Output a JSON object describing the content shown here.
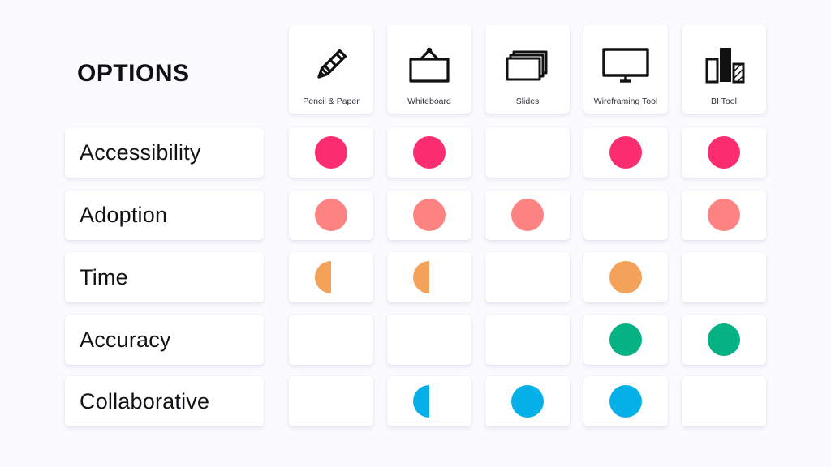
{
  "page": {
    "title": "OPTIONS",
    "background_color": "#FBFAFE"
  },
  "palette": {
    "pink": "#FB2C6F",
    "salmon": "#FD8383",
    "orange": "#F4A259",
    "green": "#05B283",
    "blue": "#05B0E8",
    "card": "#FFFFFF",
    "text": "#111014",
    "caption": "#33313B"
  },
  "columns": [
    {
      "label": "Pencil & Paper",
      "icon": "pencil-icon"
    },
    {
      "label": "Whiteboard",
      "icon": "whiteboard-icon"
    },
    {
      "label": "Slides",
      "icon": "slides-icon"
    },
    {
      "label": "Wireframing Tool",
      "icon": "monitor-icon"
    },
    {
      "label": "BI Tool",
      "icon": "bar-chart-icon"
    }
  ],
  "rows": [
    {
      "label": "Accessibility",
      "color": "#FB2C6F"
    },
    {
      "label": "Adoption",
      "color": "#FD8383"
    },
    {
      "label": "Time",
      "color": "#F4A259"
    },
    {
      "label": "Accuracy",
      "color": "#05B283"
    },
    {
      "label": "Collaborative",
      "color": "#05B0E8"
    }
  ],
  "chart_data": {
    "type": "heatmap",
    "title": "OPTIONS",
    "xlabel": "",
    "ylabel": "",
    "categories": [
      "Pencil & Paper",
      "Whiteboard",
      "Slides",
      "Wireframing Tool",
      "BI Tool"
    ],
    "row_categories": [
      "Accessibility",
      "Adoption",
      "Time",
      "Accuracy",
      "Collaborative"
    ],
    "value_scale": {
      "full": 1,
      "half": 0.5,
      "empty": 0
    },
    "series": [
      {
        "name": "Accessibility",
        "color": "#FB2C6F",
        "marks": [
          "full",
          "full",
          "empty",
          "full",
          "full"
        ],
        "values": [
          1,
          1,
          0,
          1,
          1
        ]
      },
      {
        "name": "Adoption",
        "color": "#FD8383",
        "marks": [
          "full",
          "full",
          "full",
          "empty",
          "full"
        ],
        "values": [
          1,
          1,
          1,
          0,
          1
        ]
      },
      {
        "name": "Time",
        "color": "#F4A259",
        "marks": [
          "half",
          "half",
          "empty",
          "full",
          "empty"
        ],
        "values": [
          0.5,
          0.5,
          0,
          1,
          0
        ]
      },
      {
        "name": "Accuracy",
        "color": "#05B283",
        "marks": [
          "empty",
          "empty",
          "empty",
          "full",
          "full"
        ],
        "values": [
          0,
          0,
          0,
          1,
          1
        ]
      },
      {
        "name": "Collaborative",
        "color": "#05B0E8",
        "marks": [
          "empty",
          "half",
          "full",
          "full",
          "empty"
        ],
        "values": [
          0,
          0.5,
          1,
          1,
          0
        ]
      }
    ]
  }
}
